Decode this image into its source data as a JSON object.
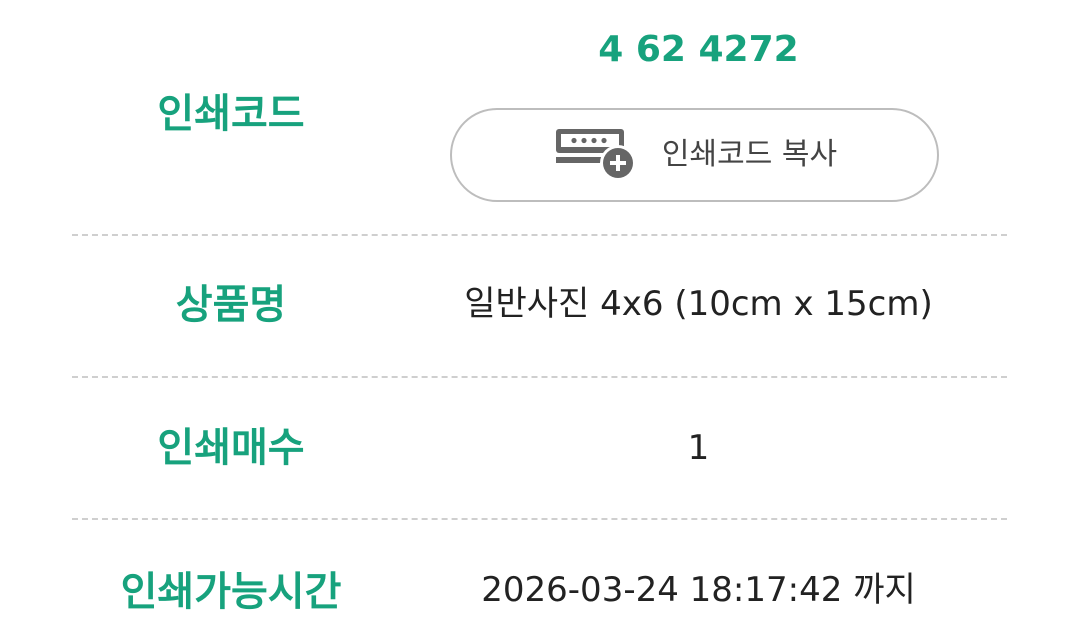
{
  "print_code": {
    "label": "인쇄코드",
    "value": "4 62 4272",
    "copy_button_label": "인쇄코드 복사",
    "icon": "keyboard-plus-icon"
  },
  "product": {
    "label": "상품명",
    "value": "일반사진 4x6 (10cm x 15cm)"
  },
  "quantity": {
    "label": "인쇄매수",
    "value": "1"
  },
  "print_deadline": {
    "label": "인쇄가능시간",
    "value": "2026-03-24 18:17:42 까지"
  },
  "colors": {
    "accent": "#17a27d",
    "divider": "#cfcfcf",
    "icon": "#666666"
  }
}
